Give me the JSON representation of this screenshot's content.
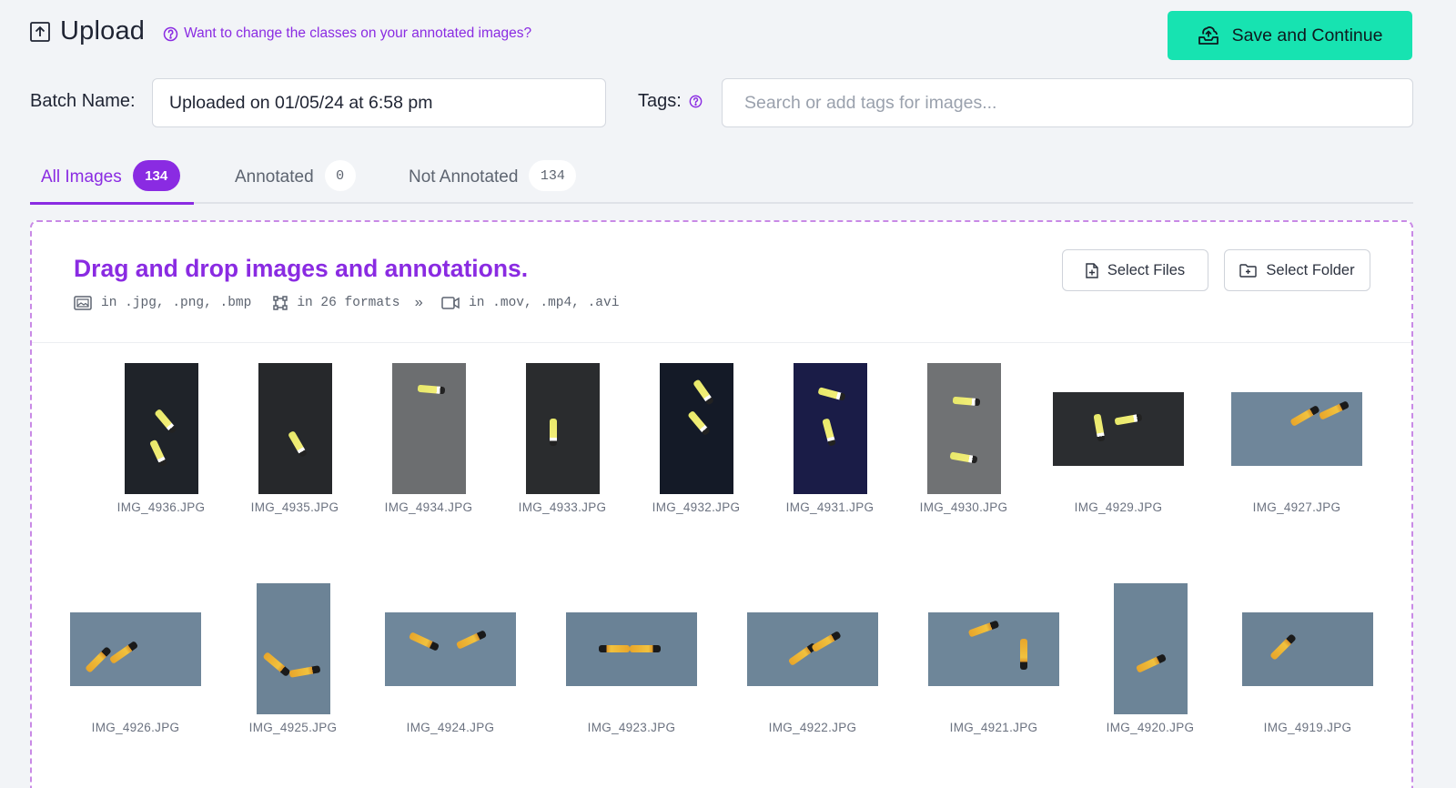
{
  "header": {
    "title": "Upload",
    "help_link": "Want to change the classes on your annotated images?",
    "save_button": "Save and Continue"
  },
  "form": {
    "batch_label": "Batch Name:",
    "batch_value": "Uploaded on 01/05/24 at 6:58 pm",
    "tags_label": "Tags:",
    "tags_placeholder": "Search or add tags for images..."
  },
  "tabs": [
    {
      "label": "All Images",
      "count": "134",
      "active": true
    },
    {
      "label": "Annotated",
      "count": "0",
      "active": false
    },
    {
      "label": "Not Annotated",
      "count": "134",
      "active": false
    }
  ],
  "dropzone": {
    "title": "Drag and drop images and annotations.",
    "image_formats": "in .jpg, .png, .bmp",
    "annotation_formats": "in 26 formats",
    "video_formats": "in .mov, .mp4, .avi",
    "select_files": "Select Files",
    "select_folder": "Select Folder"
  },
  "colors": {
    "accent": "#8a2be2",
    "save_button": "#17e3b1",
    "page_background": "#f2f4f7"
  },
  "images_row1": [
    {
      "name": "IMG_4936.JPG",
      "orientation": "portrait",
      "bg": "#1f2329"
    },
    {
      "name": "IMG_4935.JPG",
      "orientation": "portrait",
      "bg": "#26282b"
    },
    {
      "name": "IMG_4934.JPG",
      "orientation": "portrait",
      "bg": "#6c6e70"
    },
    {
      "name": "IMG_4933.JPG",
      "orientation": "portrait",
      "bg": "#2a2c2e"
    },
    {
      "name": "IMG_4932.JPG",
      "orientation": "portrait",
      "bg": "#141a27"
    },
    {
      "name": "IMG_4931.JPG",
      "orientation": "portrait",
      "bg": "#1a1c47"
    },
    {
      "name": "IMG_4930.JPG",
      "orientation": "portrait",
      "bg": "#707274"
    },
    {
      "name": "IMG_4929.JPG",
      "orientation": "landscape",
      "bg": "#2b2d30"
    },
    {
      "name": "IMG_4927.JPG",
      "orientation": "landscape",
      "bg": "#6f869a"
    }
  ],
  "images_row2": [
    {
      "name": "IMG_4926.JPG",
      "orientation": "landscape",
      "bg": "#6f869a"
    },
    {
      "name": "IMG_4925.JPG",
      "orientation": "portrait",
      "bg": "#6c8396"
    },
    {
      "name": "IMG_4924.JPG",
      "orientation": "landscape",
      "bg": "#6f879b"
    },
    {
      "name": "IMG_4923.JPG",
      "orientation": "landscape",
      "bg": "#6a8296"
    },
    {
      "name": "IMG_4922.JPG",
      "orientation": "landscape",
      "bg": "#6d8598"
    },
    {
      "name": "IMG_4921.JPG",
      "orientation": "landscape",
      "bg": "#6e8699"
    },
    {
      "name": "IMG_4920.JPG",
      "orientation": "portrait",
      "bg": "#6c8497"
    },
    {
      "name": "IMG_4919.JPG",
      "orientation": "landscape",
      "bg": "#6b8295"
    }
  ]
}
